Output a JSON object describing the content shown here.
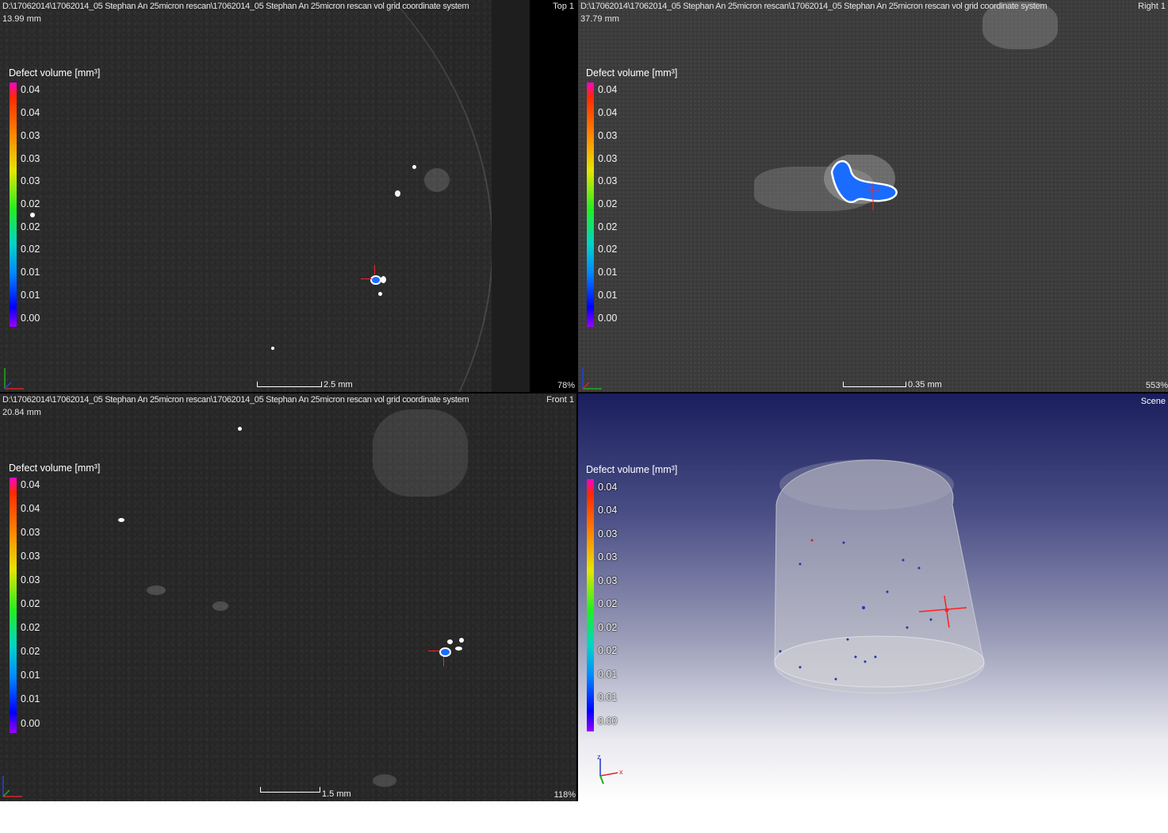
{
  "legend_title": "Defect volume [mm³]",
  "colorbar_ticks": [
    "0.04",
    "0.04",
    "0.03",
    "0.03",
    "0.03",
    "0.02",
    "0.02",
    "0.02",
    "0.01",
    "0.01",
    "0.00"
  ],
  "views": {
    "top": {
      "path": "D:\\17062014\\17062014_05 Stephan An 25micron rescan\\17062014_05 Stephan An 25micron rescan vol grid coordinate system",
      "name": "Top 1",
      "depth": "13.99 mm",
      "zoom": "78%",
      "scale": "2.5 mm"
    },
    "right": {
      "path": "D:\\17062014\\17062014_05 Stephan An 25micron rescan\\17062014_05 Stephan An 25micron rescan vol grid coordinate system",
      "name": "Right 1",
      "depth": "37.79 mm",
      "zoom": "553%",
      "scale": "0.35 mm"
    },
    "front": {
      "path": "D:\\17062014\\17062014_05 Stephan An 25micron rescan\\17062014_05 Stephan An 25micron rescan vol grid coordinate system",
      "name": "Front 1",
      "depth": "20.84 mm",
      "zoom": "118%",
      "scale": "1.5 mm"
    },
    "scene": {
      "name": "Scene"
    }
  },
  "axes": {
    "x": "x",
    "z": "z"
  },
  "colors": {
    "ct_background": "#262626",
    "defect_blue": "#1a6cff",
    "marker_red": "#ff2020",
    "scene_top": "#1a1e5c"
  }
}
